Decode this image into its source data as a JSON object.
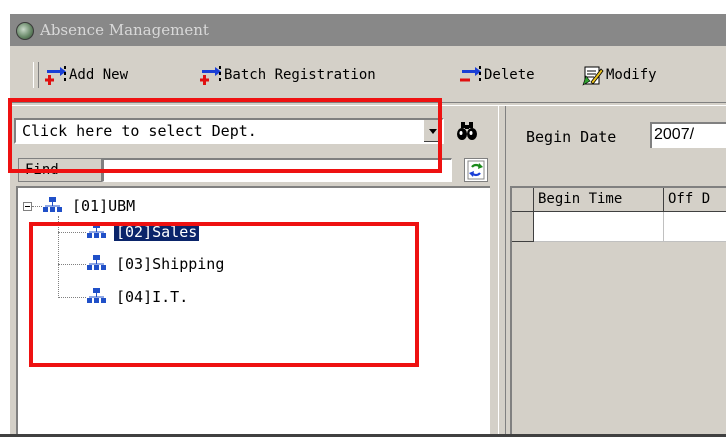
{
  "window": {
    "title": "Absence Management",
    "icon": "app-icon"
  },
  "toolbar": {
    "add_new": "Add New",
    "batch_registration": "Batch Registration",
    "delete": "Delete",
    "modify": "Modify"
  },
  "dept_select": {
    "value": "Click here to select Dept."
  },
  "find": {
    "label": "Find",
    "value": ""
  },
  "tree": {
    "root": "[01]UBM",
    "children": [
      "[02]Sales",
      "[03]Shipping",
      "[04]I.T."
    ],
    "selected": "[02]Sales"
  },
  "right_panel": {
    "begin_date_label": "Begin Date",
    "begin_date_value": "2007/",
    "columns": [
      "Begin Time",
      "Off D"
    ]
  },
  "colors": {
    "selection": "#0a246a",
    "highlight_box": "#ee1111"
  },
  "icons": [
    "app-icon",
    "add-new-icon",
    "batch-registration-icon",
    "delete-icon",
    "modify-icon",
    "binoculars-icon",
    "refresh-icon",
    "org-unit-icon"
  ]
}
